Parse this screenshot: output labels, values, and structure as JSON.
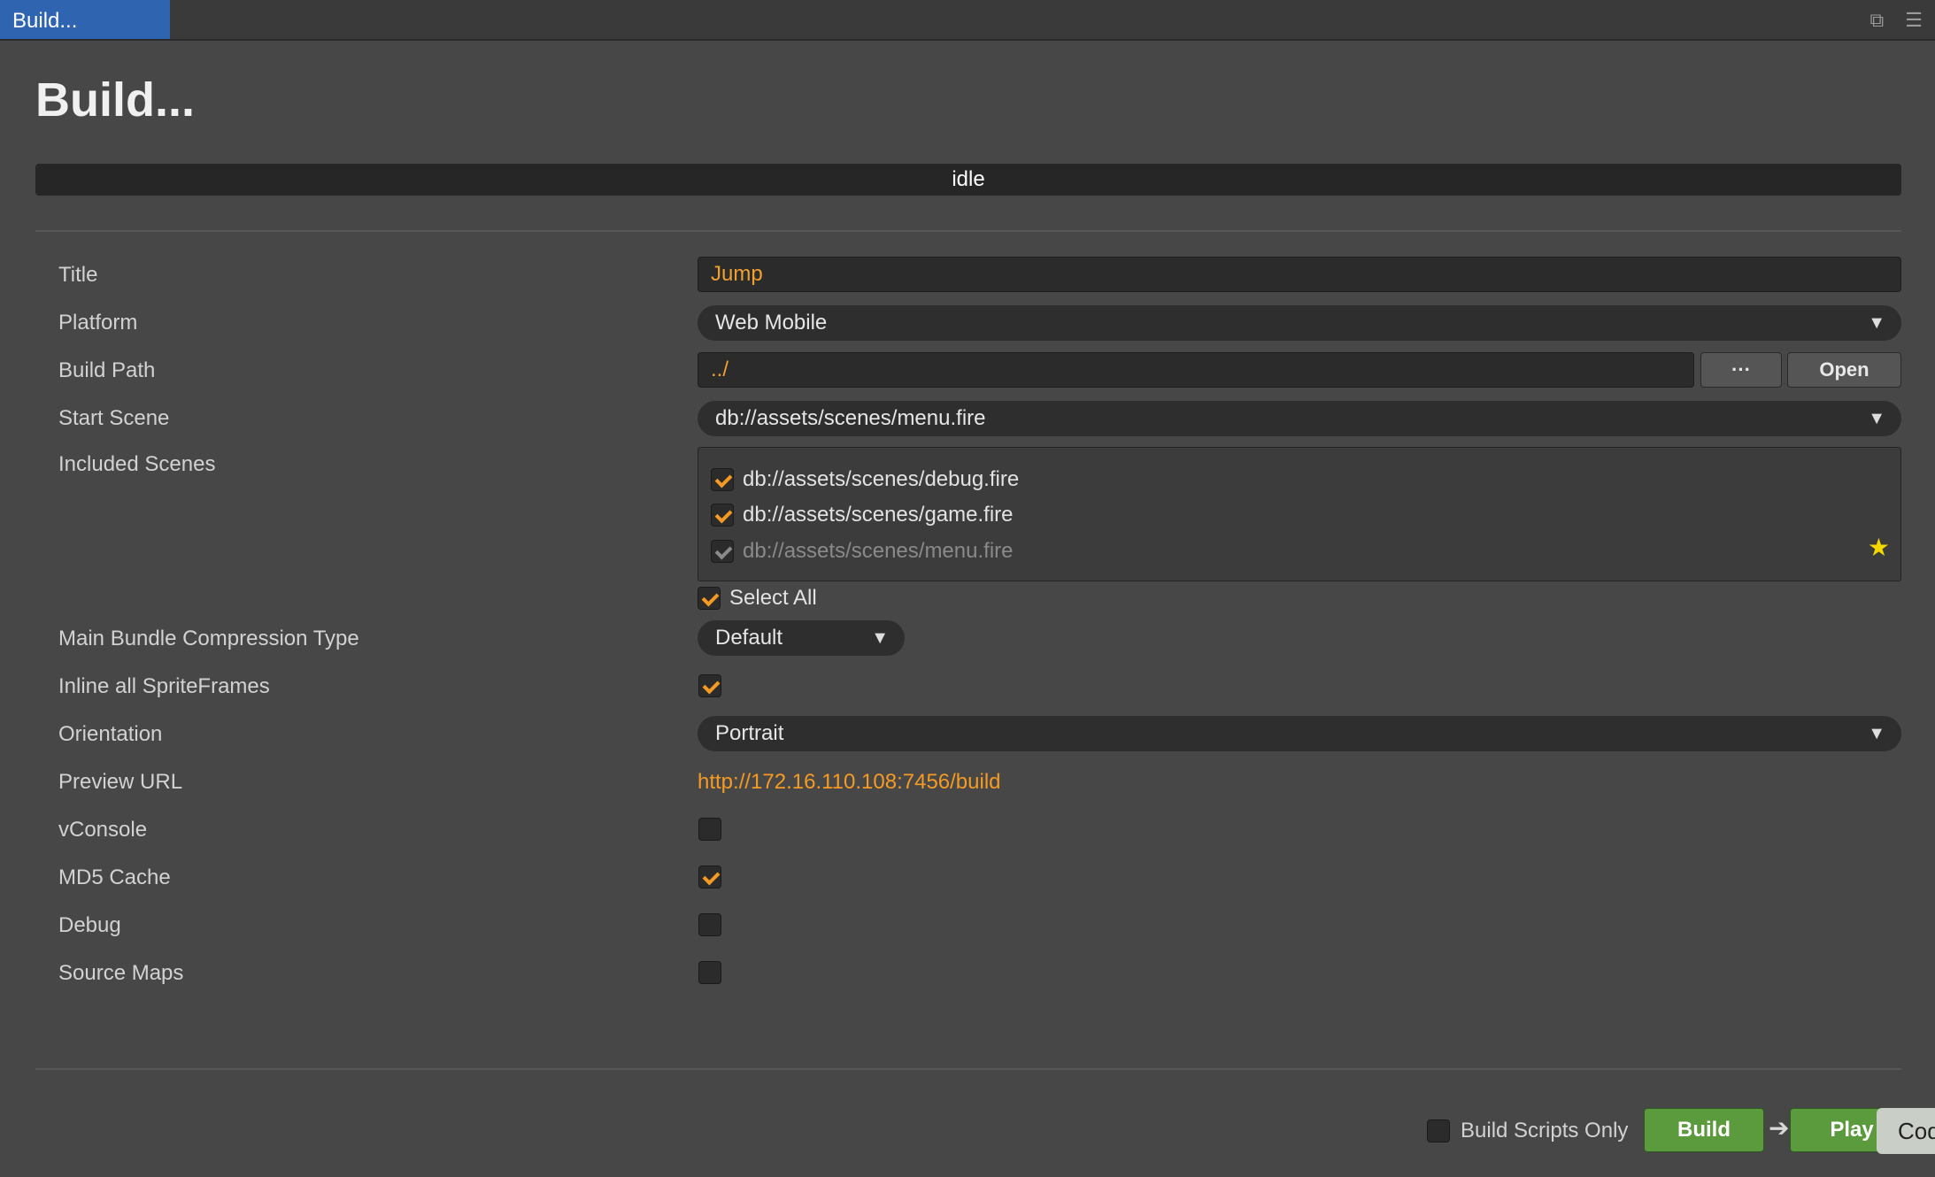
{
  "tab": {
    "title": "Build..."
  },
  "icons": {
    "restore": "restore-window-icon",
    "menu": "hamburger-menu-icon"
  },
  "header": {
    "title": "Build..."
  },
  "status": {
    "text": "idle"
  },
  "form": {
    "title": {
      "label": "Title",
      "value": "Jump"
    },
    "platform": {
      "label": "Platform",
      "value": "Web Mobile"
    },
    "build_path": {
      "label": "Build Path",
      "value": "../",
      "browse_label": "···",
      "open_label": "Open"
    },
    "start_scene": {
      "label": "Start Scene",
      "value": "db://assets/scenes/menu.fire"
    },
    "included_scenes": {
      "label": "Included Scenes",
      "items": [
        {
          "path": "db://assets/scenes/debug.fire",
          "checked": true
        },
        {
          "path": "db://assets/scenes/game.fire",
          "checked": true
        },
        {
          "path": "db://assets/scenes/menu.fire",
          "checked": true
        }
      ],
      "select_all_label": "Select All"
    },
    "compression": {
      "label": "Main Bundle Compression Type",
      "value": "Default"
    },
    "inline_sprite_frames": {
      "label": "Inline all SpriteFrames",
      "checked": true
    },
    "orientation": {
      "label": "Orientation",
      "value": "Portrait"
    },
    "preview_url": {
      "label": "Preview URL",
      "value": "http://172.16.110.108:7456/build"
    },
    "vconsole": {
      "label": "vConsole",
      "checked": false
    },
    "md5_cache": {
      "label": "MD5 Cache",
      "checked": true
    },
    "debug": {
      "label": "Debug",
      "checked": false
    },
    "source_maps": {
      "label": "Source Maps",
      "checked": false
    }
  },
  "footer": {
    "build_scripts_only_label": "Build Scripts Only",
    "build_label": "Build",
    "play_label": "Play",
    "code_label": "Code"
  },
  "colors": {
    "accent": "#f59a23",
    "tab_active": "#2f64b0",
    "primary_button": "#5c9a3e"
  }
}
